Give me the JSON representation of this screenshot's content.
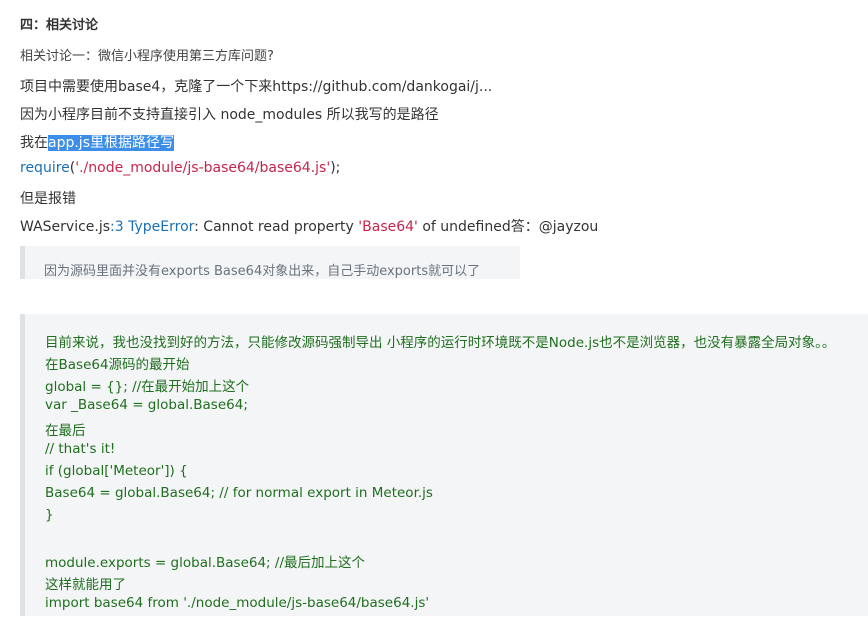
{
  "heading": "四：相关讨论",
  "subheading": "相关讨论一：微信小程序使用第三方库问题?",
  "lines": {
    "l1": "项目中需要使用base4，克隆了一个下来https://github.com/dankogai/j...",
    "l2": "因为小程序目前不支持直接引入 node_modules 所以我写的是路径",
    "l3_prefix": "我在",
    "l3_highlight": "app.js里根据路径写",
    "l4_require": "require",
    "l4_path": "'./node_module/js-base64/base64.js'",
    "l4_tail": ");",
    "l5": "但是报错",
    "l6_service": "WAService.js",
    "l6_linenum": ":3 TypeError",
    "l6_mid": ": Cannot read property ",
    "l6_base": "'Base64'",
    "l6_tail": " of undefined答：@jayzou"
  },
  "quote1": "因为源码里面并没有exports Base64对象出来，自己手动exports就可以了",
  "quote2": [
    "目前来说，我也没找到好的方法，只能修改源码强制导出 小程序的运行时环境既不是Node.js也不是浏览器，也没有暴露全局对象。。",
    "在Base64源码的最开始",
    "global = {}; //在最开始加上这个",
    "var _Base64 = global.Base64;",
    "在最后",
    "// that's it!",
    "if (global['Meteor']) {",
    "   Base64 = global.Base64; // for normal export in Meteor.js",
    "}",
    "",
    "module.exports = global.Base64; //最后加上这个",
    "这样就能用了",
    "import base64 from './node_module/js-base64/base64.js'"
  ]
}
